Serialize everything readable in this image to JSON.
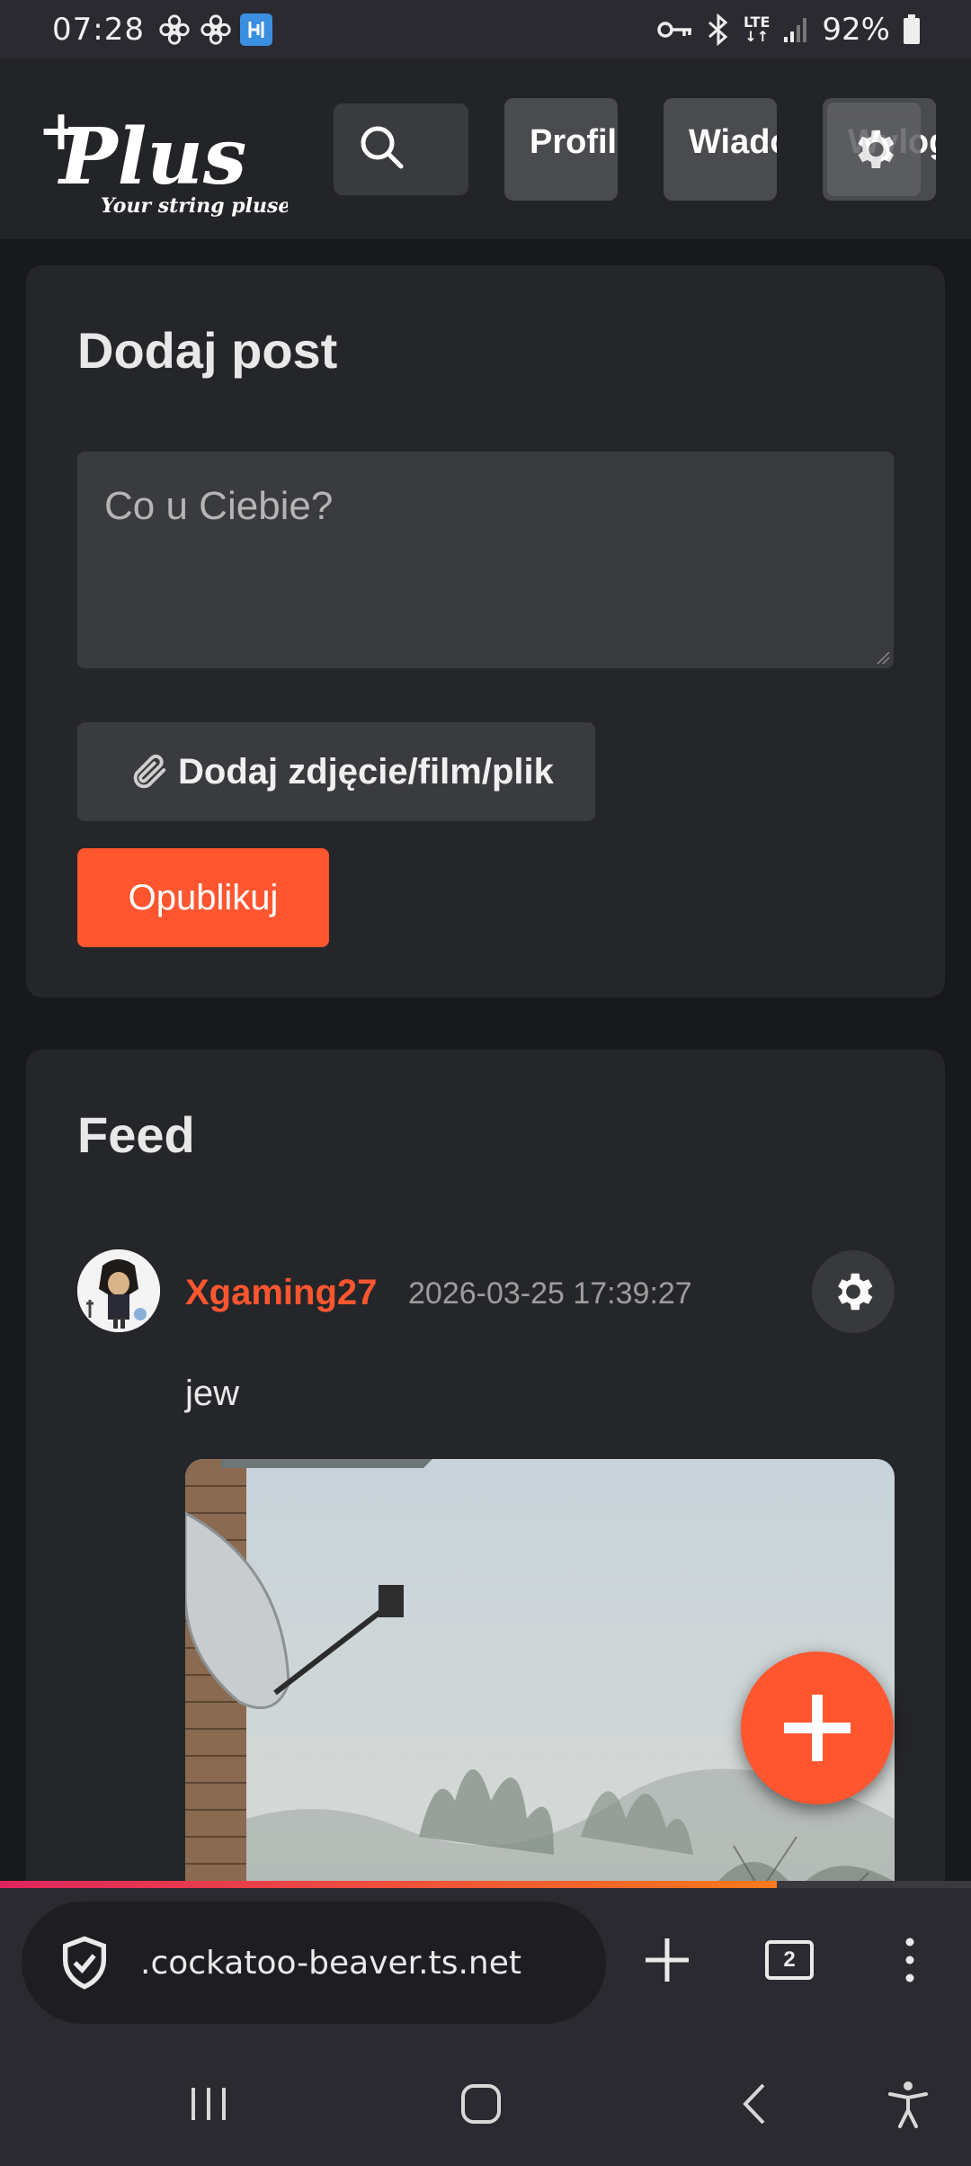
{
  "status_bar": {
    "time": "07:28",
    "battery_percent": "92%",
    "network": [
      "LTE",
      "↓↑"
    ],
    "icons": [
      "flower-icon",
      "flower-icon",
      "app-notification-icon",
      "vpn-key-icon",
      "bluetooth-icon",
      "lte-icon",
      "signal-icon",
      "battery-icon"
    ]
  },
  "navbar": {
    "logo": {
      "word": "Plus",
      "tagline": "Your string pluses"
    },
    "search_icon": "search-icon",
    "profile_label": "Profil",
    "messages_label": "Wiadomości",
    "logout_label": "Wyloguj",
    "settings_icon": "gear-icon"
  },
  "add_post": {
    "title": "Dodaj post",
    "placeholder": "Co u Ciebie?",
    "attach_icon": "paperclip-icon",
    "attach_label": "Dodaj zdjęcie/film/plik",
    "publish_label": "Opublikuj"
  },
  "feed": {
    "title": "Feed",
    "posts": [
      {
        "username": "Xgaming27",
        "timestamp": "2026-03-25 17:39:27",
        "text": "jew",
        "options_icon": "gear-icon",
        "image": "foggy-landscape-satellite-dish"
      }
    ]
  },
  "fab": {
    "icon": "plus-icon"
  },
  "page_load_progress": 0.8,
  "browser_bar": {
    "shield_icon": "shield-check-icon",
    "url": ".cockatoo-beaver.ts.net",
    "new_tab_icon": "plus-icon",
    "tab_count": "2",
    "menu_icon": "more-vertical-icon"
  },
  "system_nav": [
    "recents-icon",
    "home-icon",
    "back-icon",
    "accessibility-icon"
  ],
  "colors": {
    "accent": "#ff5630",
    "background": "#18191b",
    "card": "#252629"
  }
}
